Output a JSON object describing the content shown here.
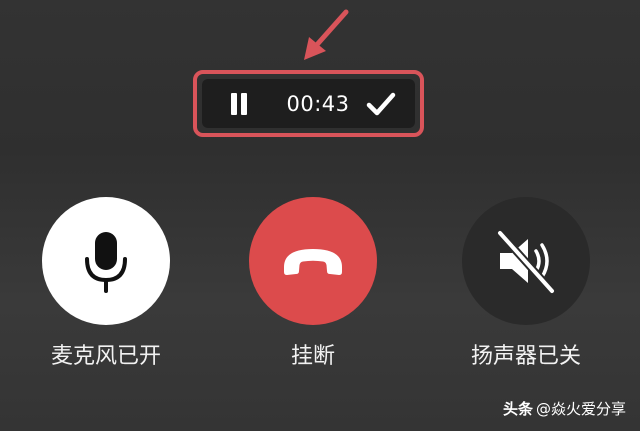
{
  "recording": {
    "timer": "00:43"
  },
  "controls": [
    {
      "label": "麦克风已开"
    },
    {
      "label": "挂断"
    },
    {
      "label": "扬声器已关"
    }
  ],
  "watermark": {
    "brand": "头条",
    "handle": "@焱火爱分享"
  },
  "colors": {
    "annotation": "#d9545a",
    "hangup": "#dc4b4c",
    "mic_bg": "#ffffff",
    "speaker_bg": "#2a2a2a",
    "bar_bg": "#1e1e1e"
  },
  "icons": {
    "annotation": "arrow-icon",
    "pause": "pause-icon",
    "confirm": "check-icon",
    "mic": "microphone-icon",
    "hangup": "phone-hangup-icon",
    "speaker": "speaker-muted-icon"
  }
}
